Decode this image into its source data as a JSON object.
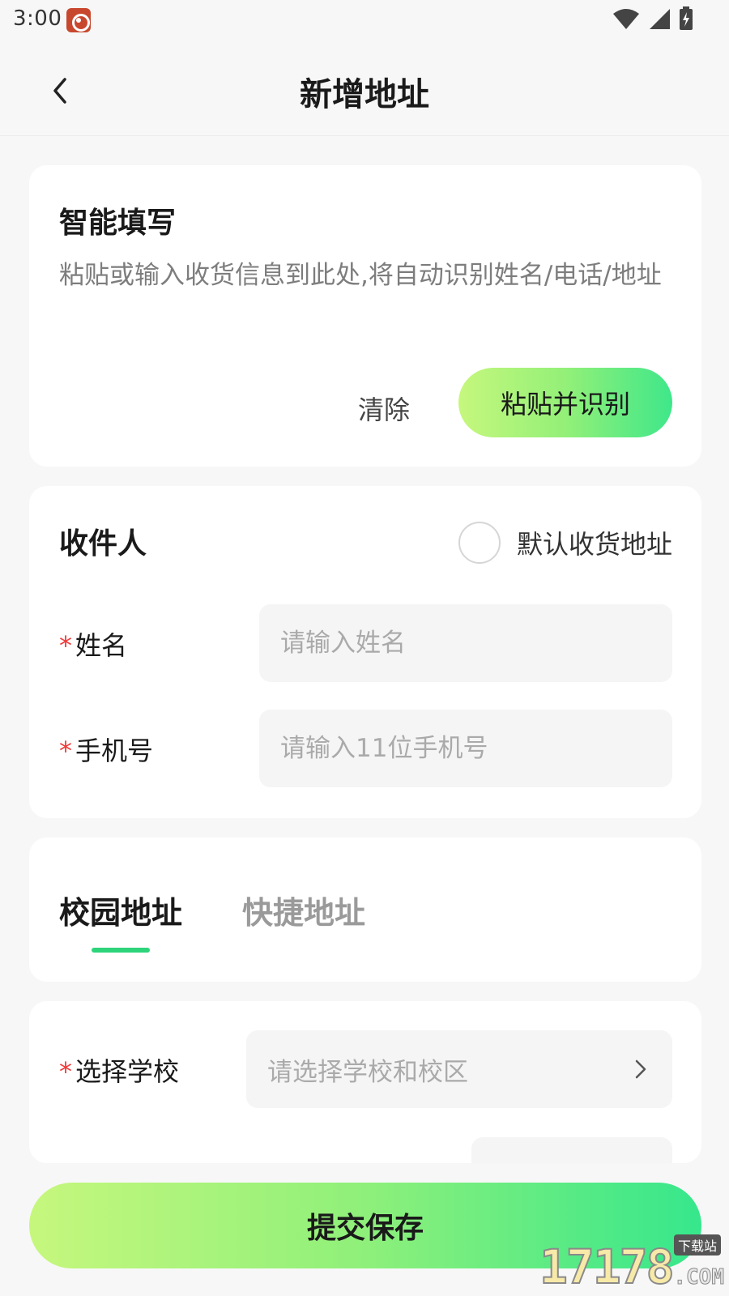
{
  "status_bar": {
    "time": "3:00",
    "icons": [
      "app-notification-icon",
      "wifi-icon",
      "cellular-signal-icon",
      "battery-charging-icon"
    ]
  },
  "navbar": {
    "title": "新增地址",
    "back_icon": "chevron-left-icon"
  },
  "smart_fill": {
    "title": "智能填写",
    "placeholder": "粘贴或输入收货信息到此处,将自动识别姓名/电话/地址",
    "clear_label": "清除",
    "paste_label": "粘贴并识别"
  },
  "recipient": {
    "title": "收件人",
    "default_label": "默认收货地址",
    "default_checked": false,
    "name_label": "姓名",
    "name_placeholder": "请输入姓名",
    "phone_label": "手机号",
    "phone_placeholder": "请输入11位手机号",
    "required_mark": "*"
  },
  "address_tabs": {
    "tabs": [
      {
        "label": "校园地址",
        "active": true
      },
      {
        "label": "快捷地址",
        "active": false
      }
    ]
  },
  "school": {
    "label": "选择学校",
    "placeholder": "请选择学校和校区",
    "chevron_icon": "chevron-right-icon"
  },
  "submit": {
    "label": "提交保存"
  },
  "watermark": {
    "number": "17178",
    "domain": ".COM",
    "tag": "下载站"
  },
  "colors": {
    "accent_green": "#2ed47a",
    "gradient_start": "#c6f77d",
    "gradient_end": "#36e78c",
    "required_red": "#f03a3a"
  }
}
